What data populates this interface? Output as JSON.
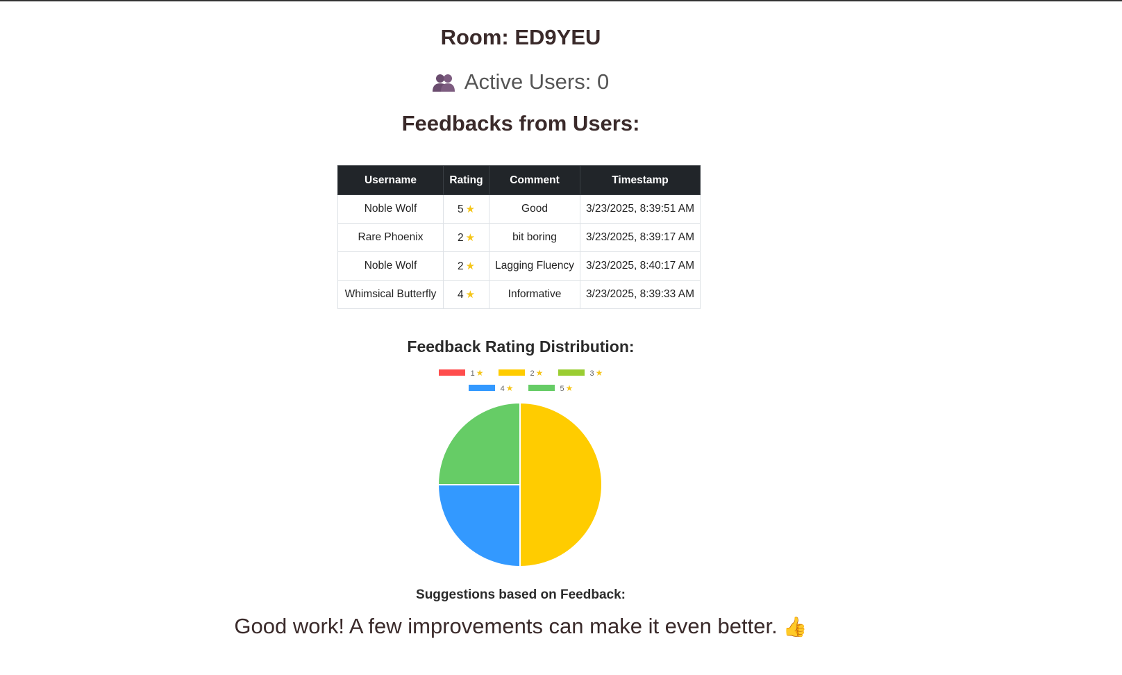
{
  "room": {
    "title": "Room: ED9YEU"
  },
  "active_users": {
    "label": "Active Users: 0",
    "icon": "users-icon"
  },
  "feedback_section": {
    "title": "Feedbacks from Users:",
    "columns": [
      "Username",
      "Rating",
      "Comment",
      "Timestamp"
    ],
    "rows": [
      {
        "username": "Noble Wolf",
        "rating": "5",
        "comment": "Good",
        "timestamp": "3/23/2025, 8:39:51 AM"
      },
      {
        "username": "Rare Phoenix",
        "rating": "2",
        "comment": "bit boring",
        "timestamp": "3/23/2025, 8:39:17 AM"
      },
      {
        "username": "Noble Wolf",
        "rating": "2",
        "comment": "Lagging Fluency",
        "timestamp": "3/23/2025, 8:40:17 AM"
      },
      {
        "username": "Whimsical Butterfly",
        "rating": "4",
        "comment": "Informative",
        "timestamp": "3/23/2025, 8:39:33 AM"
      }
    ],
    "star_icon": "star-icon",
    "star_color": "#f5c518"
  },
  "chart_data": {
    "type": "pie",
    "title": "Feedback Rating Distribution:",
    "categories": [
      "1",
      "2",
      "3",
      "4",
      "5"
    ],
    "values": [
      0,
      2,
      0,
      1,
      1
    ],
    "colors": [
      "#ff4d4d",
      "#ffcc00",
      "#9acd32",
      "#3399ff",
      "#66cc66"
    ],
    "legend_placement": "top"
  },
  "suggestions": {
    "title": "Suggestions based on Feedback:",
    "text": "Good work! A few improvements can make it even better.",
    "icon": "thumbs-up-icon"
  }
}
